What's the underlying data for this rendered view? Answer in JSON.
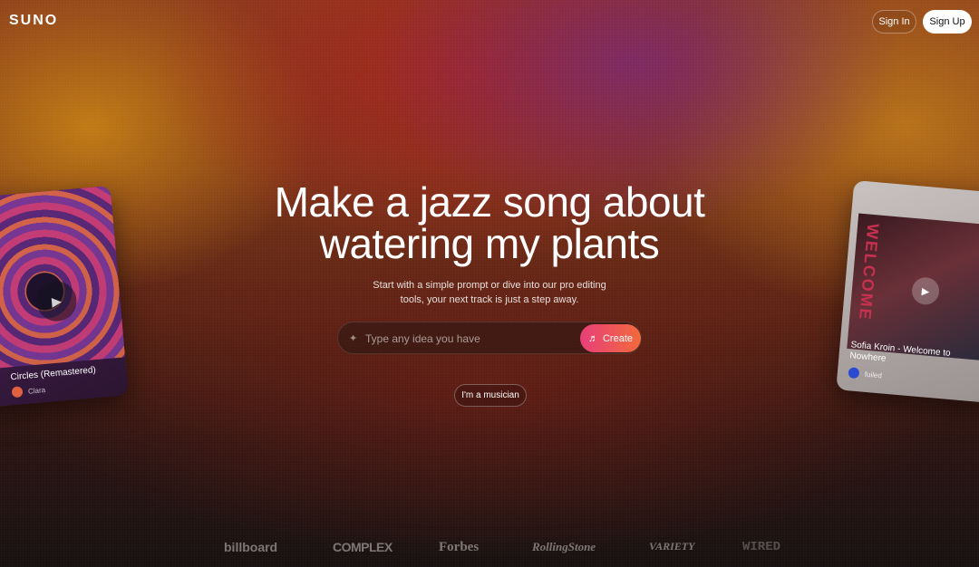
{
  "brand": {
    "logo_text": "SUNO"
  },
  "nav": {
    "sign_in": "Sign In",
    "sign_up": "Sign Up"
  },
  "hero": {
    "title_line1": "Make a jazz song about",
    "title_line2": "watering my plants",
    "subtitle_line1": "Start with a simple prompt or dive into our pro editing",
    "subtitle_line2": "tools, your next track is just a step away."
  },
  "prompt": {
    "placeholder": "Type any idea you have",
    "value": "",
    "create_label": "Create",
    "sparkle_icon": "sparkle-icon",
    "note_icon": "music-note-icon"
  },
  "musician_button": "I'm a musician",
  "cards": {
    "left": {
      "title": "Circles (Remastered)",
      "artist": "Clara"
    },
    "right": {
      "art_text": "WELCOME",
      "title": "Sofia Kroin - Welcome to Nowhere",
      "artist": "fuiled"
    }
  },
  "press": [
    "billboard",
    "COMPLEX",
    "Forbes",
    "RollingStone",
    "VARIETY",
    "WIRED"
  ],
  "colors": {
    "create_gradient_start": "#e83f7a",
    "create_gradient_end": "#f26a3c",
    "signup_bg": "#ffffff"
  }
}
